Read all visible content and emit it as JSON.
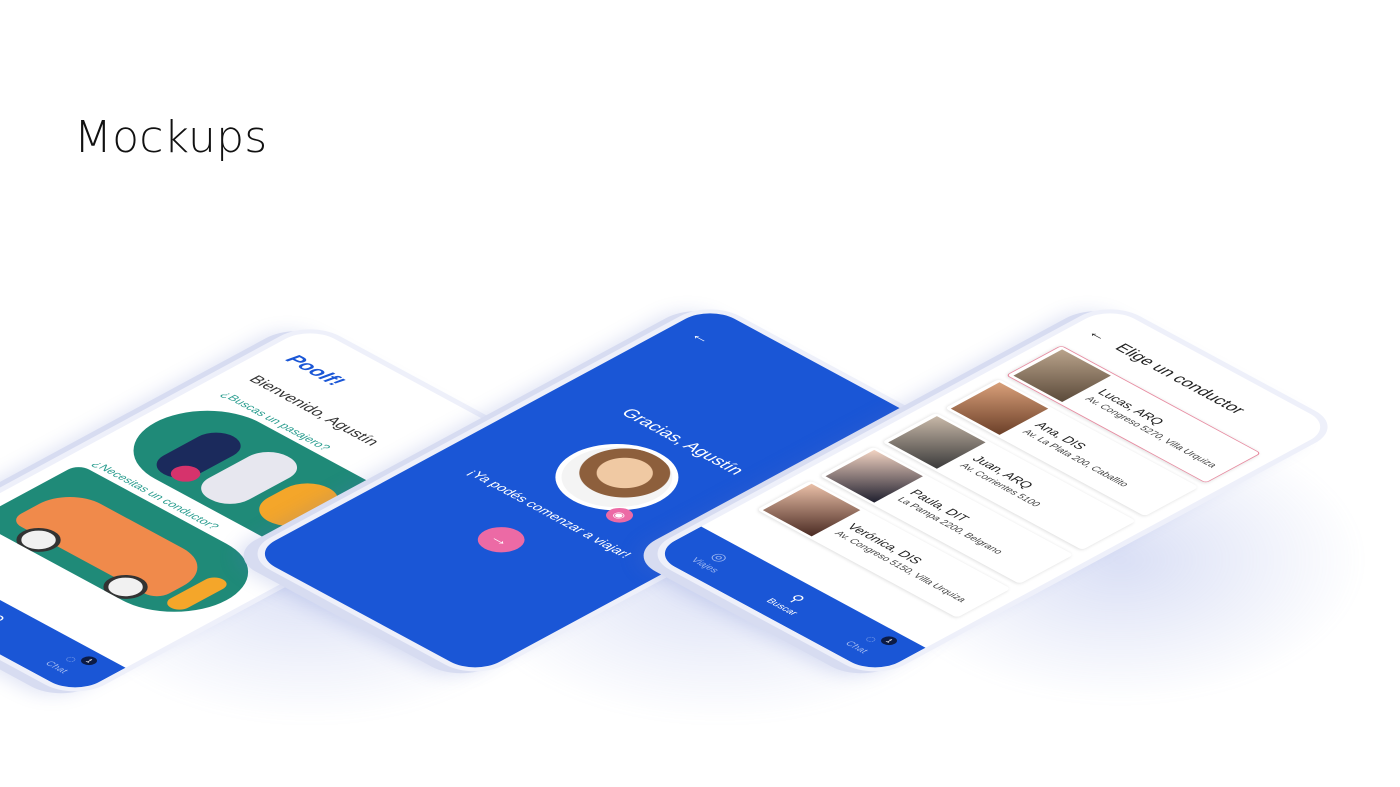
{
  "page": {
    "title": "Mockups"
  },
  "nav": {
    "viajes": "Viajes",
    "buscar": "Buscar",
    "chat": "Chat",
    "chat_badge": "1"
  },
  "phone1": {
    "logo": "Poolf!",
    "welcome": "Bienvenido, Agustín",
    "question_passenger": "¿Buscas un pasajero?",
    "question_driver": "¿Necesitas un conductor?"
  },
  "phone2": {
    "back": "←",
    "title": "Gracias, Agustín",
    "message": "¡Ya podés comenzar a viajar!",
    "next": "→"
  },
  "phone3": {
    "back": "←",
    "title": "Elige un conductor",
    "drivers": [
      {
        "name": "Lucas, ARQ",
        "address": "Av. Congreso 5270, Villa Urquiza"
      },
      {
        "name": "Ana, DIS",
        "address": "Av. La Plata 200, Caballito"
      },
      {
        "name": "Juan, ARQ",
        "address": "Av. Corrientes 5100"
      },
      {
        "name": "Paula, DIT",
        "address": "La Pampa 2200, Belgrano"
      },
      {
        "name": "Verónica, DIS",
        "address": "Av. Congreso 5150, Villa Urquiza"
      }
    ]
  },
  "colors": {
    "primary": "#1a56d6",
    "accent_pink": "#ec6aa5",
    "teal": "#1f8a78",
    "orange": "#f08a4b"
  }
}
